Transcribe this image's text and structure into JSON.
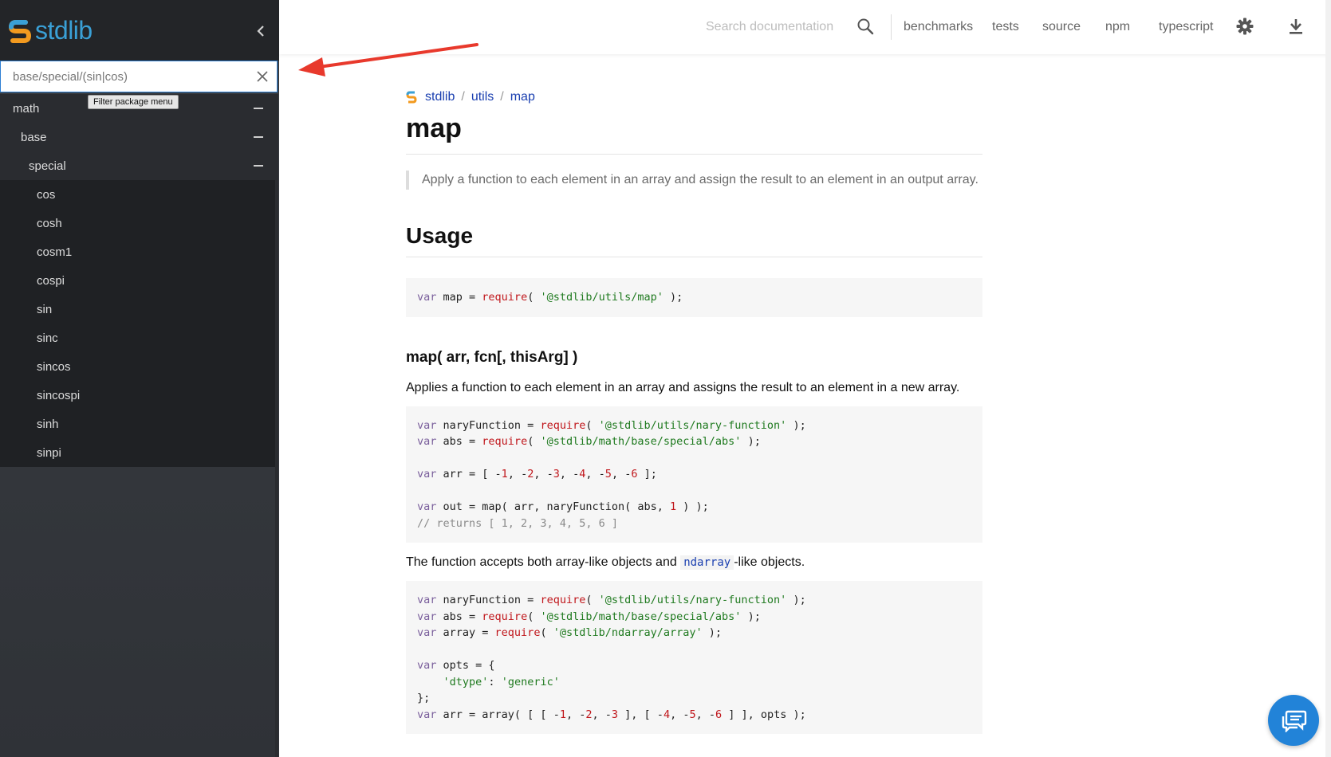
{
  "sidebar": {
    "logo_text": "stdlib",
    "filter": {
      "value": "base/special/(sin|cos)",
      "tooltip": "Filter package menu"
    },
    "tree": [
      {
        "label": "math",
        "level": 0,
        "expanded": true
      },
      {
        "label": "base",
        "level": 1,
        "expanded": true
      },
      {
        "label": "special",
        "level": 2,
        "expanded": true
      }
    ],
    "leaves": [
      "cos",
      "cosh",
      "cosm1",
      "cospi",
      "sin",
      "sinc",
      "sincos",
      "sincospi",
      "sinh",
      "sinpi"
    ]
  },
  "topbar": {
    "search_placeholder": "Search documentation",
    "links": [
      "benchmarks",
      "tests",
      "source",
      "npm",
      "typescript"
    ],
    "icons": [
      "search-icon",
      "gear-icon",
      "download-icon"
    ]
  },
  "breadcrumb": [
    "stdlib",
    "utils",
    "map"
  ],
  "page": {
    "title": "map",
    "description": "Apply a function to each element in an array and assign the result to an element in an output array.",
    "usage_heading": "Usage",
    "signature": "map( arr, fcn[, thisArg] )",
    "signature_desc": "Applies a function to each element in an array and assigns the result to an element in a new array.",
    "accepts_text_before": "The function accepts both array-like objects and",
    "accepts_code": "ndarray",
    "accepts_text_after": "-like objects."
  },
  "colors": {
    "accent": "#2283d8",
    "link": "#1a3fb0",
    "sidebar_bg": "#2f3237",
    "arrow": "#e8392c"
  }
}
